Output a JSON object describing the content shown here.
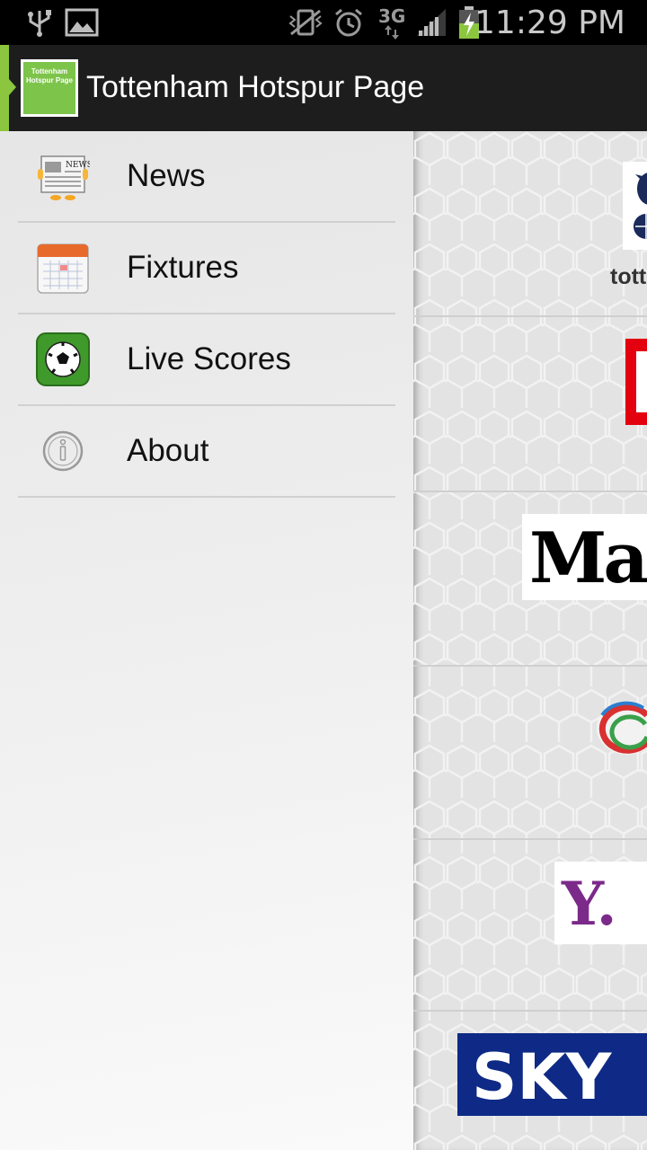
{
  "status_bar": {
    "time": "11:29 PM",
    "network": "3G",
    "icons": [
      "usb-icon",
      "image-icon",
      "vibrate-icon",
      "alarm-icon",
      "3g-icon",
      "signal-icon",
      "battery-charging-icon"
    ]
  },
  "action_bar": {
    "app_icon_text": "Tottenham Hotspur Page",
    "title": "Tottenham Hotspur Page"
  },
  "drawer": {
    "items": [
      {
        "label": "News",
        "icon": "newspaper-icon"
      },
      {
        "label": "Fixtures",
        "icon": "calendar-icon"
      },
      {
        "label": "Live Scores",
        "icon": "soccer-ball-icon"
      },
      {
        "label": "About",
        "icon": "info-icon"
      }
    ]
  },
  "content": {
    "rows": [
      {
        "source": "tottenham",
        "caption": "tott"
      },
      {
        "source": "daily-mirror"
      },
      {
        "source": "daily-mail",
        "logo_text": "Ma"
      },
      {
        "source": "espn"
      },
      {
        "source": "yahoo",
        "logo_text": "Y."
      },
      {
        "source": "sky-sports",
        "logo_text": "SKY"
      }
    ]
  },
  "colors": {
    "accent": "#8cc63f",
    "action_bar": "#1d1d1d",
    "yahoo_purple": "#7b2a8a",
    "sky_blue": "#0e2a86",
    "mirror_red": "#e3000f"
  }
}
